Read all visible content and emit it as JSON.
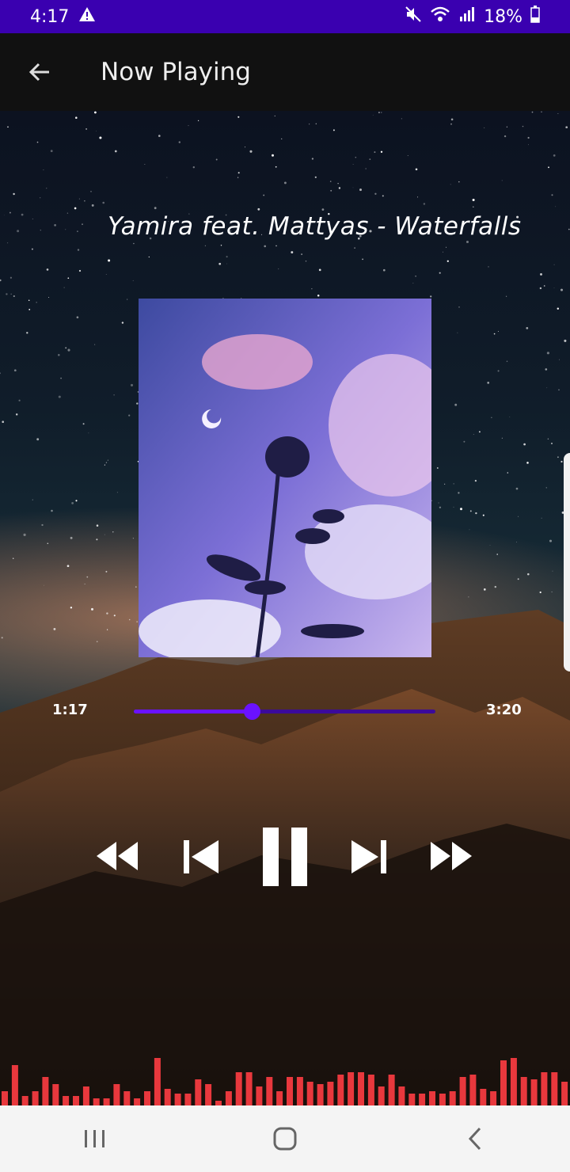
{
  "status_bar": {
    "time": "4:17",
    "battery": "18%",
    "icons": [
      "alert-icon",
      "mute-icon",
      "wifi-icon",
      "signal-icon",
      "battery-icon"
    ],
    "color": "#3a00b0"
  },
  "app_bar": {
    "title": "Now Playing",
    "back_icon": "arrow-left-icon"
  },
  "player": {
    "song_title": "Yamira feat. Mattyas - Waterfalls",
    "elapsed": "1:17",
    "duration": "3:20",
    "progress": 0.39,
    "accent_color": "#6a12ff",
    "controls": [
      "rewind-icon",
      "skip-previous-icon",
      "pause-icon",
      "skip-next-icon",
      "fast-forward-icon"
    ]
  },
  "visualizer": {
    "color": "#e8383d",
    "levels": [
      0.3,
      0.85,
      0.2,
      0.3,
      0.6,
      0.45,
      0.2,
      0.2,
      0.4,
      0.15,
      0.15,
      0.45,
      0.3,
      0.15,
      0.3,
      1.0,
      0.35,
      0.25,
      0.25,
      0.55,
      0.45,
      0.1,
      0.3,
      0.7,
      0.7,
      0.4,
      0.6,
      0.3,
      0.6,
      0.6,
      0.5,
      0.45,
      0.5,
      0.65,
      0.7,
      0.7,
      0.65,
      0.4,
      0.65,
      0.4,
      0.25,
      0.25,
      0.3,
      0.25,
      0.3,
      0.6,
      0.65,
      0.35,
      0.3,
      0.95,
      1.0,
      0.6,
      0.55,
      0.7,
      0.7,
      0.5
    ]
  },
  "nav_bar": {
    "icons": [
      "recents-icon",
      "home-icon",
      "back-icon"
    ]
  }
}
